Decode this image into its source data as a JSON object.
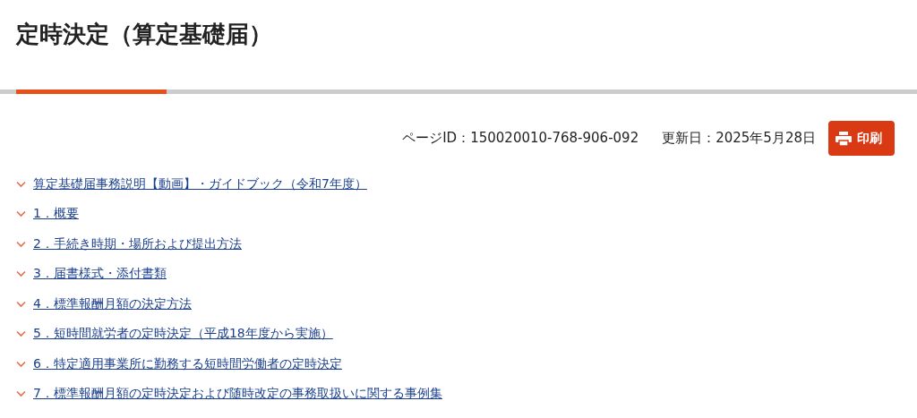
{
  "title": "定時決定（算定基礎届）",
  "meta": {
    "page_id": "ページID：150020010-768-906-092",
    "updated": "更新日：2025年5月28日",
    "print_button": "印刷"
  },
  "links": [
    {
      "label": "算定基礎届事務説明【動画】・ガイドブック（令和7年度）"
    },
    {
      "label": "1．概要"
    },
    {
      "label": "2．手続き時期・場所および提出方法"
    },
    {
      "label": "3．届書様式・添付書類"
    },
    {
      "label": "4．標準報酬月額の決定方法"
    },
    {
      "label": "5．短時間就労者の定時決定（平成18年度から実施）"
    },
    {
      "label": "6．特定適用事業所に勤務する短時間労働者の定時決定"
    },
    {
      "label": "7．標準報酬月額の定時決定および随時改定の事務取扱いに関する事例集"
    }
  ]
}
